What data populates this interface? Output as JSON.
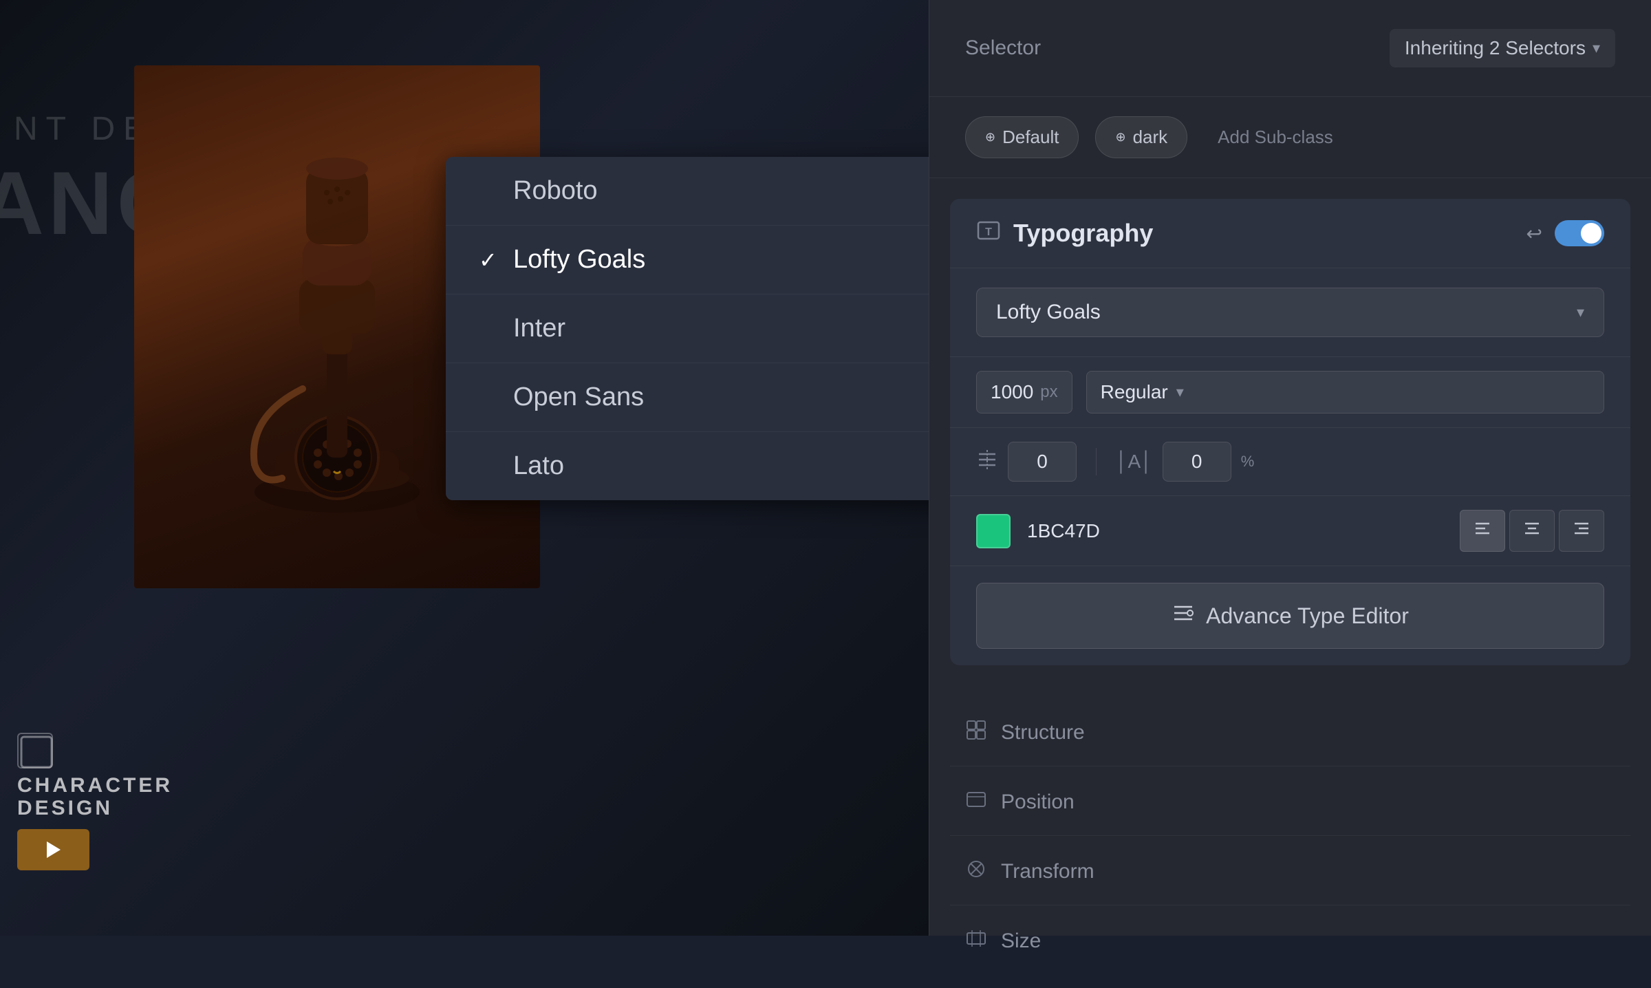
{
  "canvas": {
    "bg_text_1": "NT DESIGN",
    "bg_text_2": "ANCE +",
    "card_title_1": "CHARACTER",
    "card_title_2": "DESIGN",
    "play_button_label": "▶"
  },
  "font_dropdown": {
    "items": [
      {
        "label": "Roboto",
        "selected": false
      },
      {
        "label": "Lofty Goals",
        "selected": true
      },
      {
        "label": "Inter",
        "selected": false
      },
      {
        "label": "Open Sans",
        "selected": false
      },
      {
        "label": "Lato",
        "selected": false
      }
    ]
  },
  "selector": {
    "label": "Selector",
    "value": "Inheriting 2 Selectors"
  },
  "subclasses": {
    "default_label": "Default",
    "dark_label": "dark",
    "add_label": "Add Sub-class"
  },
  "typography": {
    "section_title": "Typography",
    "font_name": "Lofty Goals",
    "font_size": "1000",
    "font_size_unit": "px",
    "font_weight": "Regular",
    "line_height_value": "0",
    "letter_spacing_value": "0",
    "letter_spacing_unit": "%",
    "color_hex": "1BC47D",
    "advance_btn_label": "Advance Type Editor"
  },
  "other_sections": [
    {
      "label": "Structure"
    },
    {
      "label": "Position"
    },
    {
      "label": "Transform"
    },
    {
      "label": "Size"
    }
  ]
}
